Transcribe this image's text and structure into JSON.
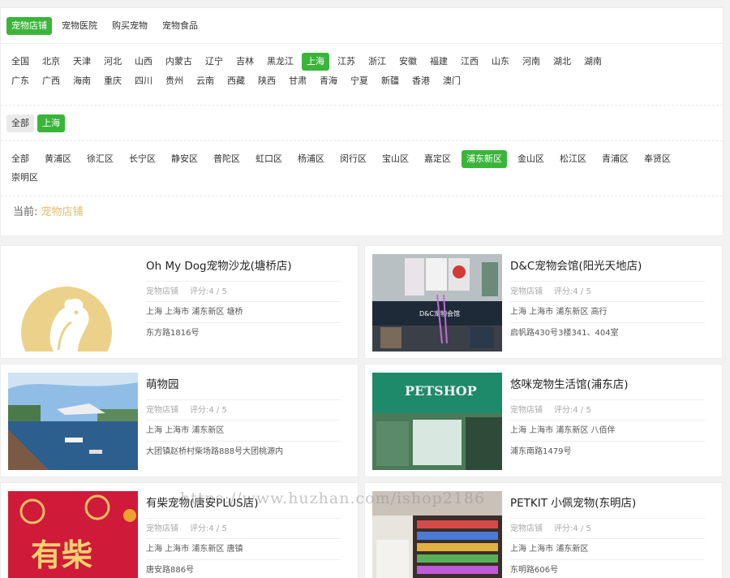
{
  "categories": [
    "宠物店铺",
    "宠物医院",
    "购买宠物",
    "宠物食品"
  ],
  "provinces_row1": [
    "全国",
    "北京",
    "天津",
    "河北",
    "山西",
    "内蒙古",
    "辽宁",
    "吉林",
    "黑龙江",
    "上海",
    "江苏",
    "浙江",
    "安徽",
    "福建",
    "江西",
    "山东",
    "河南",
    "湖北",
    "湖南"
  ],
  "provinces_row2": [
    "广东",
    "广西",
    "海南",
    "重庆",
    "四川",
    "贵州",
    "云南",
    "西藏",
    "陕西",
    "甘肃",
    "青海",
    "宁夏",
    "新疆",
    "香港",
    "澳门"
  ],
  "cities": [
    "全部",
    "上海"
  ],
  "districts_row1": [
    "全部",
    "黄浦区",
    "徐汇区",
    "长宁区",
    "静安区",
    "普陀区",
    "虹口区",
    "杨浦区",
    "闵行区",
    "宝山区",
    "嘉定区",
    "浦东新区",
    "金山区",
    "松江区",
    "青浦区",
    "奉贤区"
  ],
  "districts_row2": [
    "崇明区"
  ],
  "current": {
    "label": "当前:",
    "value": "宠物店铺"
  },
  "stores": [
    {
      "name": "Oh My Dog宠物沙龙(塘桥店)",
      "category": "宠物店铺",
      "rating": "评分:4 / 5",
      "addr1": "上海 上海市 浦东新区 塘桥",
      "addr2": "东方路1816号"
    },
    {
      "name": "D&C宠物会馆(阳光天地店)",
      "category": "宠物店铺",
      "rating": "评分:4 / 5",
      "addr1": "上海 上海市 浦东新区 高行",
      "addr2": "启帆路430号3楼341、404室"
    },
    {
      "name": "萌物园",
      "category": "宠物店铺",
      "rating": "评分:4 / 5",
      "addr1": "上海 上海市 浦东新区",
      "addr2": "大团镇赵桥村柴场路888号大团桃源内"
    },
    {
      "name": "悠咪宠物生活馆(浦东店)",
      "category": "宠物店铺",
      "rating": "评分:4 / 5",
      "addr1": "上海 上海市 浦东新区 八佰伴",
      "addr2": "浦东南路1479号"
    },
    {
      "name": "有柴宠物(唐安PLUS店)",
      "category": "宠物店铺",
      "rating": "评分:4 / 5",
      "addr1": "上海 上海市 浦东新区 唐镇",
      "addr2": "唐安路886号"
    },
    {
      "name": "PETKIT 小佩宠物(东明店)",
      "category": "宠物店铺",
      "rating": "评分:4 / 5",
      "addr1": "上海 上海市 浦东新区",
      "addr2": "东明路606号"
    }
  ],
  "thumb_text": {
    "dc_sign": "D&C宠物会馆",
    "petshop": "PETSHOP",
    "youchai": "有柴"
  },
  "watermark": "https://www.huzhan.com/ishop2186",
  "colors": {
    "accent": "#3ab53a",
    "current_value": "#e0be6c",
    "logo_gold": "#ecd18a"
  }
}
